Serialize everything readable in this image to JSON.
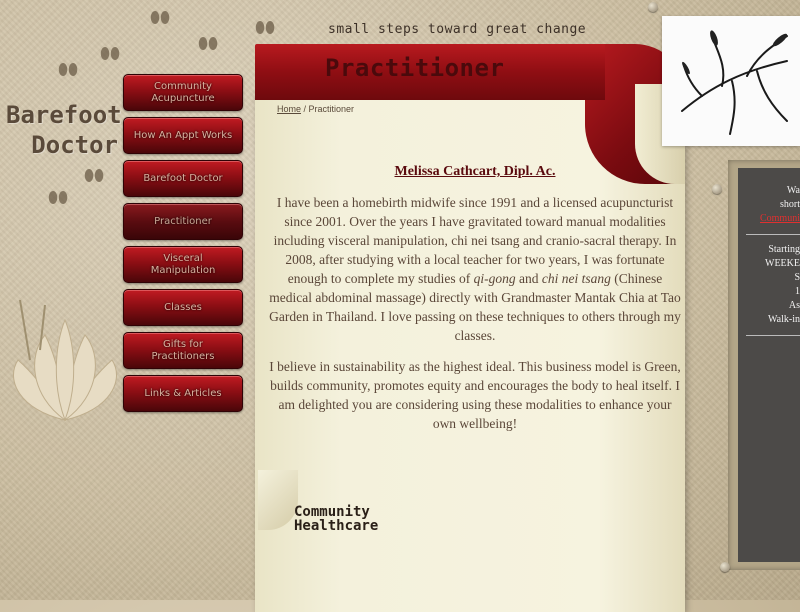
{
  "site": {
    "title_line1": "Barefoot",
    "title_line2": "Doctor",
    "tagline": "small steps toward great change"
  },
  "nav": {
    "items": [
      {
        "label": "Community Acupuncture",
        "active": false
      },
      {
        "label": "How An Appt Works",
        "active": false
      },
      {
        "label": "Barefoot Doctor",
        "active": false
      },
      {
        "label": "Practitioner",
        "active": true
      },
      {
        "label": "Visceral Manipulation",
        "active": false
      },
      {
        "label": "Classes",
        "active": false
      },
      {
        "label": "Gifts for Practitioners",
        "active": false
      },
      {
        "label": "Links & Articles",
        "active": false
      }
    ]
  },
  "page": {
    "heading": "Practitioner",
    "breadcrumb_home": "Home",
    "breadcrumb_sep": " / ",
    "breadcrumb_current": "Practitioner"
  },
  "content": {
    "name": "Melissa Cathcart, Dipl. Ac.",
    "p1_a": "I have been a homebirth midwife since 1991 and a licensed acupuncturist since 2001.  Over the years I have gravitated toward manual modalities including visceral manipulation, chi nei tsang and cranio-sacral therapy.  In 2008, after studying with a local teacher for two years, I was fortunate enough to complete my studies of ",
    "p1_em1": "qi-gong",
    "p1_b": " and ",
    "p1_em2": "chi nei tsang",
    "p1_c": " (Chinese medical abdominal massage) directly with Grandmaster Mantak Chia at Tao Garden in Thailand.  I love passing on these techniques to others through my classes.",
    "p2": "I believe in sustainability as the highest ideal.  This business model is Green, builds community, promotes equity and encourages the body to heal itself.  I am delighted you are considering using these modalities to enhance your own wellbeing!"
  },
  "footer_logo": {
    "line1": "Community",
    "line2": "Healthcare"
  },
  "right_panel": {
    "line1": "Wa",
    "line2": "short",
    "link": "Communi",
    "line3": "Starting",
    "line4": "WEEKE",
    "line5": "S",
    "line6": "1",
    "line7": "As",
    "line8": "Walk-in"
  },
  "colors": {
    "nav_red": "#8c0e14",
    "header_red": "#b81a1f",
    "paper": "#f6f3df",
    "panel_dark": "#4c4a48"
  }
}
